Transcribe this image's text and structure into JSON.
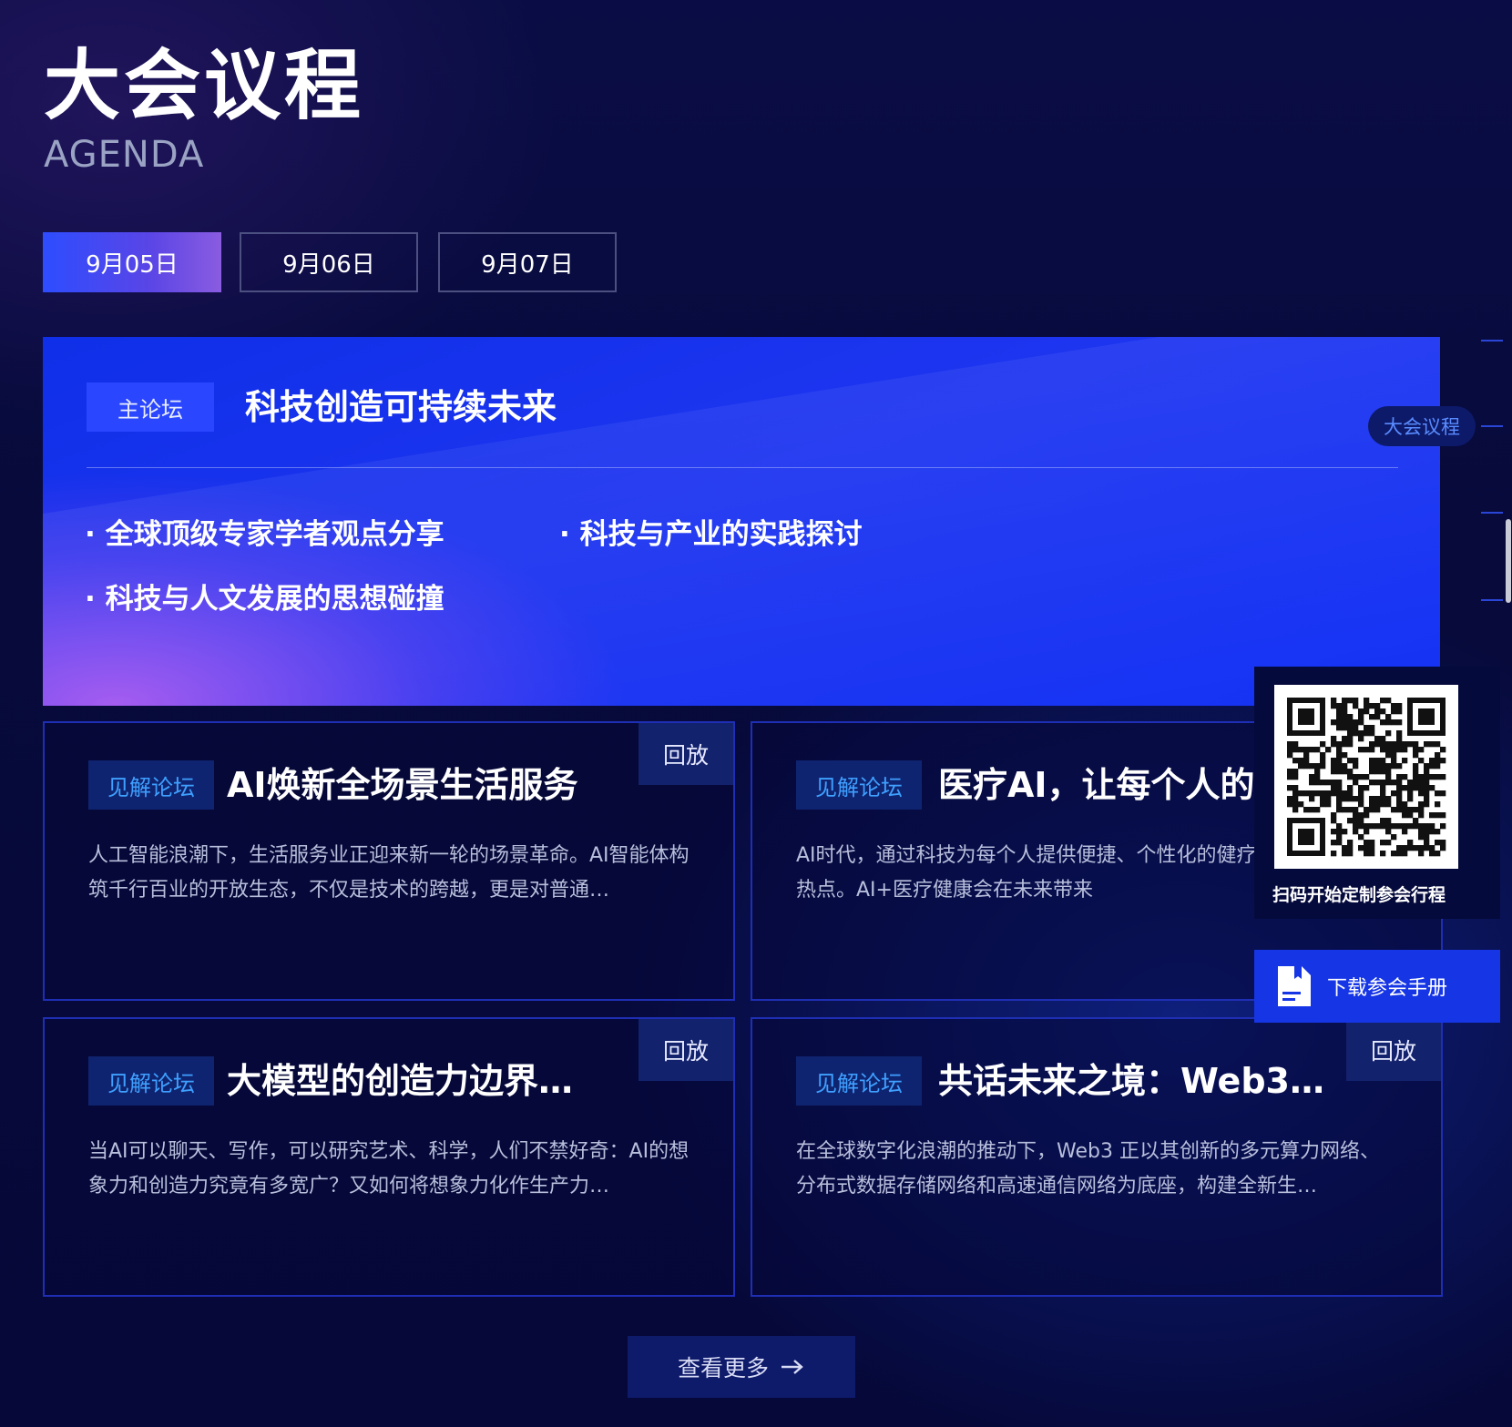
{
  "header": {
    "title": "大会议程",
    "subtitle": "AGENDA"
  },
  "date_tabs": [
    {
      "label": "9月05日",
      "active": true
    },
    {
      "label": "9月06日",
      "active": false
    },
    {
      "label": "9月07日",
      "active": false
    }
  ],
  "main_forum": {
    "tag": "主论坛",
    "title": "科技创造可持续未来",
    "bullets": [
      "· 全球顶级专家学者观点分享",
      "· 科技与产业的实践探讨",
      "· 科技与人文发展的思想碰撞"
    ]
  },
  "cards": [
    {
      "tag": "见解论坛",
      "title": "AI焕新全场景生活服务",
      "desc": "人工智能浪潮下，生活服务业正迎来新一轮的场景革命。AI智能体构筑千行百业的开放生态，不仅是技术的跨越，更是对普通…",
      "replay": "回放"
    },
    {
      "tag": "见解论坛",
      "title": "医疗AI，让每个人的",
      "desc": "AI时代，通过科技为每个人提供便捷、个性化的健疗健康行业关注的热点。AI+医疗健康会在未来带来",
      "replay": ""
    },
    {
      "tag": "见解论坛",
      "title": "大模型的创造力边界…",
      "desc": "当AI可以聊天、写作，可以研究艺术、科学，人们不禁好奇：AI的想象力和创造力究竟有多宽广？又如何将想象力化作生产力…",
      "replay": "回放"
    },
    {
      "tag": "见解论坛",
      "title": "共话未来之境：Web3…",
      "desc": "在全球数字化浪潮的推动下，Web3 正以其创新的多元算力网络、分布式数据存储网络和高速通信网络为底座，构建全新生…",
      "replay": "回放"
    }
  ],
  "see_more": {
    "label": "查看更多",
    "icon": "arrow-right-icon"
  },
  "side_nav": {
    "active_label": "大会议程"
  },
  "qr_panel": {
    "caption": "扫码开始定制参会行程",
    "icon": "qr-code-icon"
  },
  "download": {
    "label": "下载参会手册",
    "icon": "document-icon"
  },
  "colors": {
    "background": "#070a3a",
    "banner_blue": "#1533f5",
    "accent_blue": "#2a47ff",
    "tag_text": "#3fa0ff",
    "card_border": "#1f2fb5"
  }
}
